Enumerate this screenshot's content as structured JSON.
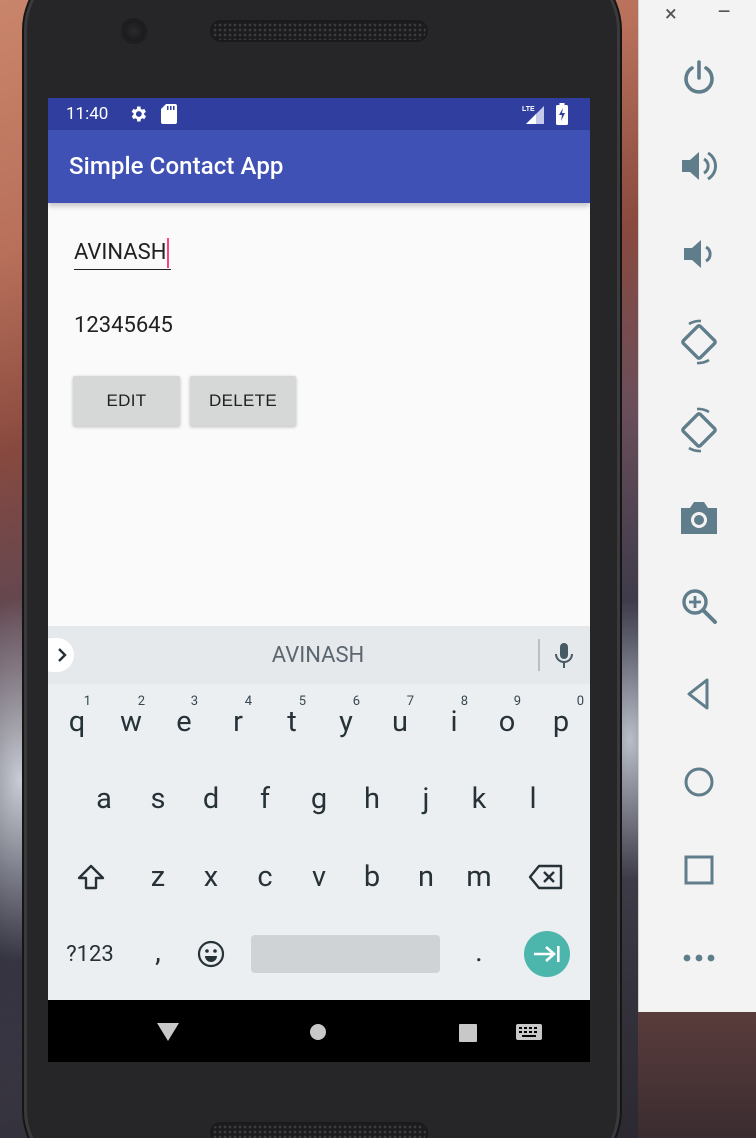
{
  "statusbar": {
    "time": "11:40",
    "network": "LTE"
  },
  "app": {
    "title": "Simple Contact App",
    "name_value": "AVINASH",
    "phone_value": "12345645",
    "edit_label": "EDIT",
    "delete_label": "DELETE"
  },
  "keyboard": {
    "suggestion": "AVINASH",
    "row1": [
      {
        "k": "q",
        "h": "1"
      },
      {
        "k": "w",
        "h": "2"
      },
      {
        "k": "e",
        "h": "3"
      },
      {
        "k": "r",
        "h": "4"
      },
      {
        "k": "t",
        "h": "5"
      },
      {
        "k": "y",
        "h": "6"
      },
      {
        "k": "u",
        "h": "7"
      },
      {
        "k": "i",
        "h": "8"
      },
      {
        "k": "o",
        "h": "9"
      },
      {
        "k": "p",
        "h": "0"
      }
    ],
    "row2": [
      "a",
      "s",
      "d",
      "f",
      "g",
      "h",
      "j",
      "k",
      "l"
    ],
    "row3": [
      "z",
      "x",
      "c",
      "v",
      "b",
      "n",
      "m"
    ],
    "symbols_label": "?123",
    "comma_label": ",",
    "period_label": "."
  },
  "navbar": {
    "icons": [
      "back-icon",
      "home-icon",
      "recents-icon",
      "keyboard-switch-icon"
    ]
  },
  "emulator_panel": {
    "close_label": "×",
    "minimize_label": "–",
    "icons": [
      "power-icon",
      "volume-up-icon",
      "volume-down-icon",
      "rotate-left-icon",
      "rotate-right-icon",
      "camera-icon",
      "zoom-icon",
      "back-icon",
      "home-icon",
      "overview-icon",
      "more-icon"
    ]
  },
  "colors": {
    "primary": "#3f51b5",
    "primary_dark": "#303f9f",
    "accent": "#ff4081",
    "enter_key": "#4db6ac"
  }
}
